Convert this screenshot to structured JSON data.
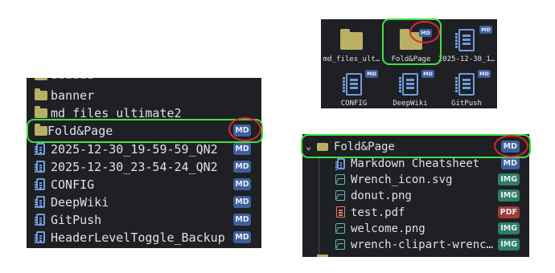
{
  "left_list": {
    "partial_top_label": "▪▪▪▪▪▪",
    "items": [
      {
        "icon": "folder",
        "label": "banner",
        "badge": ""
      },
      {
        "icon": "folder",
        "label": "md_files_ultimate2",
        "badge": ""
      },
      {
        "icon": "folder",
        "label": "Fold&Page",
        "badge": "MD",
        "highlighted": true
      },
      {
        "icon": "document",
        "label": "2025-12-30_19-59-59_QN2",
        "badge": "MD"
      },
      {
        "icon": "document",
        "label": "2025-12-30_23-54-24_QN2",
        "badge": "MD"
      },
      {
        "icon": "document",
        "label": "CONFIG",
        "badge": "MD"
      },
      {
        "icon": "document",
        "label": "DeepWiki",
        "badge": "MD"
      },
      {
        "icon": "document",
        "label": "GitPush",
        "badge": "MD"
      },
      {
        "icon": "document",
        "label": "HeaderLevelToggle_Backup",
        "badge": "MD"
      }
    ]
  },
  "icon_grid": {
    "items": [
      {
        "icon": "folder",
        "label": "md_files_ult…",
        "badge": ""
      },
      {
        "icon": "folder",
        "label": "Fold&Page",
        "badge": "MD",
        "highlighted": true
      },
      {
        "icon": "document",
        "label": "2025-12-30_1…",
        "badge": "MD"
      },
      {
        "icon": "document",
        "label": "CONFIG",
        "badge": "MD"
      },
      {
        "icon": "document",
        "label": "DeepWiki",
        "badge": "MD"
      },
      {
        "icon": "document",
        "label": "GitPush",
        "badge": "MD"
      }
    ]
  },
  "tree": {
    "folder": {
      "label": "Fold&Page",
      "badge": "MD",
      "expanded": true,
      "chevron": "⌄"
    },
    "children": [
      {
        "icon": "document",
        "label": "Markdown Cheatsheet",
        "badge": "MD"
      },
      {
        "icon": "image",
        "label": "Wrench_icon.svg",
        "badge": "IMG"
      },
      {
        "icon": "image",
        "label": "donut.png",
        "badge": "IMG"
      },
      {
        "icon": "pdf",
        "label": "test.pdf",
        "badge": "PDF"
      },
      {
        "icon": "image",
        "label": "welcome.png",
        "badge": "IMG"
      },
      {
        "icon": "image",
        "label": "wrench-clipart-wrenc…",
        "badge": "IMG"
      }
    ]
  },
  "colors": {
    "panel_bg": "#1e2023",
    "folder": "#b9b063",
    "document": "#6f9be0",
    "badge_md": "#3e5f9f",
    "badge_img": "#2e7f63",
    "badge_pdf": "#a03a36",
    "highlight_green": "#3fe13f",
    "highlight_red": "#e3252f"
  }
}
